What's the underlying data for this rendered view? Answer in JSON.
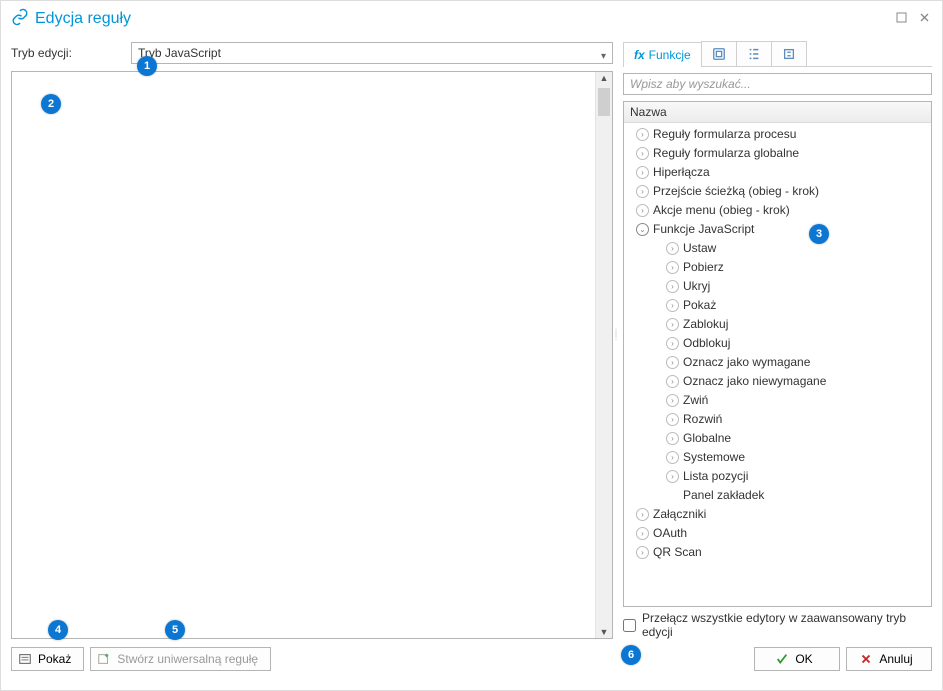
{
  "window": {
    "title": "Edycja reguły"
  },
  "mode": {
    "label": "Tryb edycji:",
    "selected": "Tryb JavaScript"
  },
  "search": {
    "placeholder": "Wpisz aby wyszukać..."
  },
  "tabs": {
    "functions": "Funkcje"
  },
  "tree": {
    "header": "Nazwa",
    "items": [
      {
        "label": "Reguły formularza procesu",
        "level": 0,
        "icon": "arrow"
      },
      {
        "label": "Reguły formularza globalne",
        "level": 0,
        "icon": "arrow"
      },
      {
        "label": "Hiperłącza",
        "level": 0,
        "icon": "arrow"
      },
      {
        "label": "Przejście ścieżką (obieg - krok)",
        "level": 0,
        "icon": "arrow"
      },
      {
        "label": "Akcje menu (obieg - krok)",
        "level": 0,
        "icon": "arrow"
      },
      {
        "label": "Funkcje JavaScript",
        "level": 0,
        "icon": "expanded"
      },
      {
        "label": "Ustaw",
        "level": 1,
        "icon": "arrow"
      },
      {
        "label": "Pobierz",
        "level": 1,
        "icon": "arrow"
      },
      {
        "label": "Ukryj",
        "level": 1,
        "icon": "arrow"
      },
      {
        "label": "Pokaż",
        "level": 1,
        "icon": "arrow"
      },
      {
        "label": "Zablokuj",
        "level": 1,
        "icon": "arrow"
      },
      {
        "label": "Odblokuj",
        "level": 1,
        "icon": "arrow"
      },
      {
        "label": "Oznacz jako wymagane",
        "level": 1,
        "icon": "arrow"
      },
      {
        "label": "Oznacz jako niewymagane",
        "level": 1,
        "icon": "arrow"
      },
      {
        "label": "Zwiń",
        "level": 1,
        "icon": "arrow"
      },
      {
        "label": "Rozwiń",
        "level": 1,
        "icon": "arrow"
      },
      {
        "label": "Globalne",
        "level": 1,
        "icon": "arrow"
      },
      {
        "label": "Systemowe",
        "level": 1,
        "icon": "arrow"
      },
      {
        "label": "Lista pozycji",
        "level": 1,
        "icon": "arrow"
      },
      {
        "label": "Panel zakładek",
        "level": 1,
        "icon": "none"
      },
      {
        "label": "Załączniki",
        "level": 0,
        "icon": "arrow"
      },
      {
        "label": "OAuth",
        "level": 0,
        "icon": "arrow"
      },
      {
        "label": "QR Scan",
        "level": 0,
        "icon": "arrow"
      }
    ]
  },
  "advanced": {
    "label": "Przełącz wszystkie edytory w zaawansowany tryb edycji"
  },
  "footer": {
    "show": "Pokaż",
    "universal": "Stwórz uniwersalną regułę",
    "ok": "OK",
    "cancel": "Anuluj"
  },
  "badges": [
    "1",
    "2",
    "3",
    "4",
    "5",
    "6"
  ]
}
